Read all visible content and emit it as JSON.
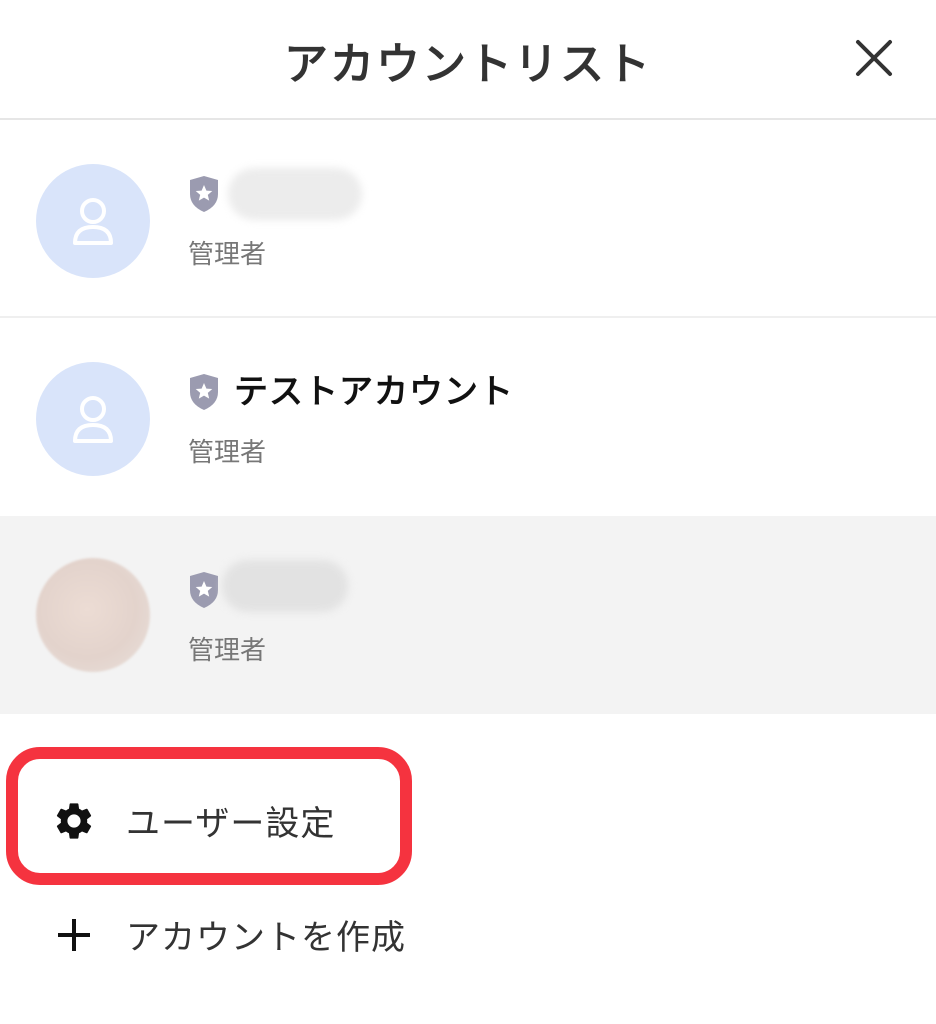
{
  "header": {
    "title": "アカウントリスト",
    "close_icon": "close-icon"
  },
  "accounts": [
    {
      "name": "",
      "role": "管理者",
      "avatar": "person-placeholder",
      "name_redacted": true
    },
    {
      "name": "テストアカウント",
      "role": "管理者",
      "avatar": "person-placeholder",
      "name_redacted": false
    },
    {
      "name": "",
      "role": "管理者",
      "avatar": "photo-redacted",
      "name_redacted": true,
      "selected": true
    }
  ],
  "menu": {
    "user_settings_label": "ユーザー設定",
    "create_account_label": "アカウントを作成"
  },
  "colors": {
    "avatar_bg": "#d9e4fa",
    "selected_row_bg": "#f3f3f3",
    "highlight": "#f5333f",
    "shield": "#9b9bb0"
  }
}
